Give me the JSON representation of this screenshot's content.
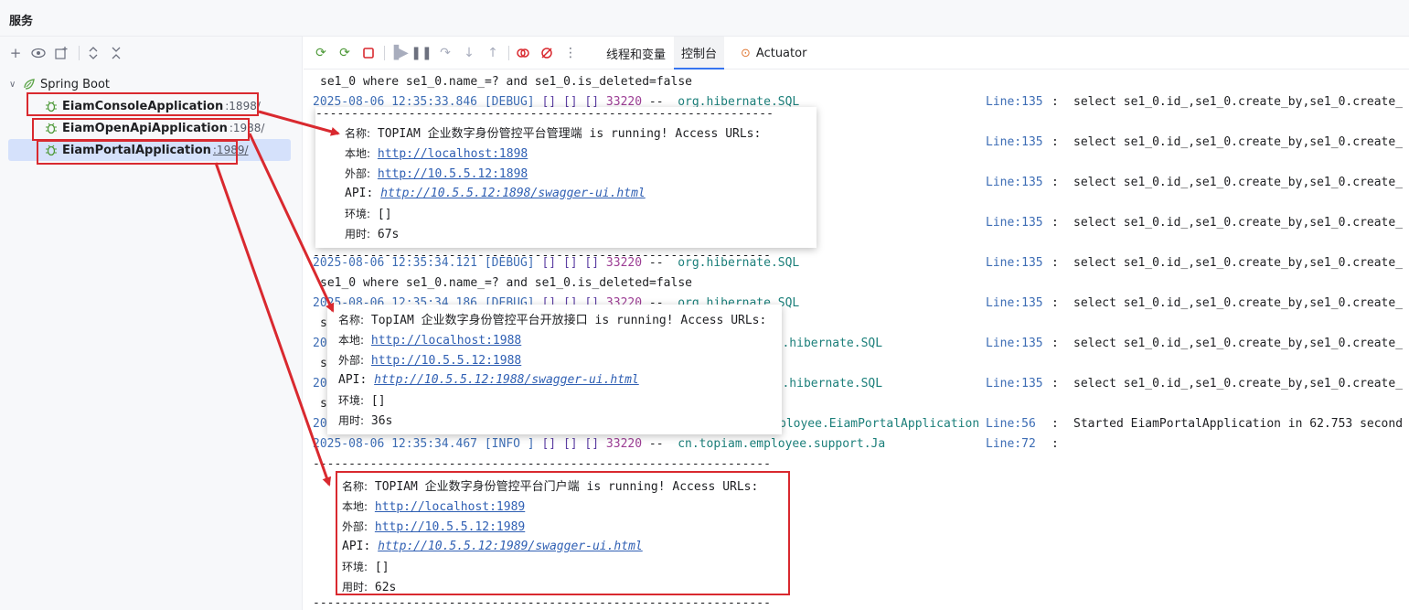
{
  "window": {
    "title": "服务"
  },
  "left_toolbar": {
    "icons": [
      "add-icon",
      "eye-icon",
      "new-config-icon",
      "expand-all-icon",
      "collapse-all-icon"
    ]
  },
  "tree": {
    "group": "Spring Boot",
    "apps": [
      {
        "name": "EiamConsoleApplication",
        "port": ":1898/"
      },
      {
        "name": "EiamOpenApiApplication",
        "port": ":1988/"
      },
      {
        "name": "EiamPortalApplication",
        "port": ":1989/"
      }
    ]
  },
  "right_toolbar": {
    "tabs": {
      "threads": "线程和变量",
      "console": "控制台",
      "actuator": "Actuator"
    }
  },
  "console": {
    "line0": "se1_0 where se1_0.name_=? and se1_0.is_deleted=false",
    "debug_prefix_ts": "2025-08-06 12:35:33.846",
    "debug_level": "[DEBUG]",
    "brackets": "[] [] []",
    "pid": "33220",
    "sep": "--",
    "sql_logger": "org.hibernate.SQL",
    "line_label": "Line:135",
    "colon": ":",
    "select_msg": "select se1_0.id_,se1_0.create_by,se1_0.create_",
    "line_mid_ts": "2025-08-06 12:35:34.121",
    "line_mid2_ts": "2025-08-06 12:35:34.186",
    "where_line": "se1_0 where se1_0.name_=? and se1_0.is_deleted=false",
    "started_logger": "ployee.EiamPortalApplication",
    "started_line": "Line:56",
    "started_msg": "Started EiamPortalApplication in 62.753 second",
    "info_ts": "2025-08-06 12:35:34.467",
    "info_level": "[INFO ]",
    "info_logger": "cn.topiam.employee.support.Ja",
    "info_line": "Line:72",
    "dashes": "----------------------------------------------------------------",
    "partial_year": "202",
    "partial_s": "s",
    "partial_year2": "20"
  },
  "popups": [
    {
      "name_label": "名称:",
      "name_value": "TOPIAM 企业数字身份管控平台管理端 is running! Access URLs:",
      "local_label": "本地:",
      "local_url": "http://localhost:1898",
      "external_label": "外部:",
      "external_url": "http://10.5.5.12:1898",
      "api_label": "API:",
      "api_url": "http://10.5.5.12:1898/swagger-ui.html",
      "env_label": "环境:",
      "env_value": "[]",
      "time_label": "用时:",
      "time_value": "67s"
    },
    {
      "name_label": "名称:",
      "name_value": "TopIAM 企业数字身份管控平台开放接口 is running! Access URLs:",
      "local_label": "本地:",
      "local_url": "http://localhost:1988",
      "external_label": "外部:",
      "external_url": "http://10.5.5.12:1988",
      "api_label": "API:",
      "api_url": "http://10.5.5.12:1988/swagger-ui.html",
      "env_label": "环境:",
      "env_value": "[]",
      "time_label": "用时:",
      "time_value": "36s"
    },
    {
      "name_label": "名称:",
      "name_value": "TOPIAM 企业数字身份管控平台门户端 is running! Access URLs:",
      "local_label": "本地:",
      "local_url": "http://localhost:1989",
      "external_label": "外部:",
      "external_url": "http://10.5.5.12:1989",
      "api_label": "API:",
      "api_url": "http://10.5.5.12:1989/swagger-ui.html",
      "env_label": "环境:",
      "env_value": "[]",
      "time_label": "用时:",
      "time_value": "62s"
    }
  ],
  "colors": {
    "highlight": "#d9292f",
    "link": "#2f5fb3",
    "selection": "#d5e1fb",
    "accent": "#3574f0"
  }
}
